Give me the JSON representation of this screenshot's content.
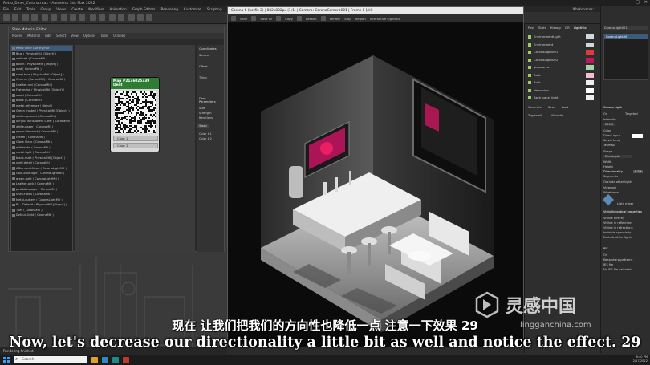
{
  "app": {
    "title": "Retro_Diner_Corona.max - Autodesk 3ds Max 2022",
    "workspace_label": "Workspaces:",
    "workspace_value": "Default",
    "menu": [
      "File",
      "Edit",
      "Tools",
      "Group",
      "Views",
      "Create",
      "Modifiers",
      "Animation",
      "Graph Editors",
      "Rendering",
      "Customize",
      "Scripting",
      "Content",
      "Civil View",
      "Substance"
    ]
  },
  "slate_editor": {
    "title": "Slate Material Editor",
    "menu": [
      "Modes",
      "Material",
      "Edit",
      "Select",
      "View",
      "Options",
      "Tools",
      "Utilities"
    ],
    "browser_items": [
      "Retro diner Library.mat",
      "Blue ( PhysicalMtl [Object] )",
      "wall-red ( CoronaMtl )",
      "booth ( PhysicalMtl [Object] )",
      "mat ( CoronaMtl )",
      "steel blue ( PhysicalMtl [Object] )",
      "Chrome (CoronaMtl) ( CoronaMtl )",
      "Leather-red ( CoronaMtl )",
      "Flat metal ( PhysicalMtl [Object] )",
      "wood ( CoronaMtl )",
      "Black ( CoronaMtl )",
      "metal-reference ( Blend )",
      "Green frosted ( PhysicalMtl [Object] )",
      "white-squared ( CoronaMtl )",
      "Acrylic Transparent Clear ( CoronaMtl )",
      "white-paper ( CoronaMtl )",
      "paper-tile-mark ( CoronaMtl )",
      "cream ( CoronaMtl )",
      "Glass Clear ( CoronaMtl )",
      "milkshake ( CoronaMtl )",
      "metal-light ( CoronaMtl )",
      "black-matt ( PhysicalMtl [Object] )",
      "shelf-detail ( CoronaMtl )",
      "ADiamond-Neon ( CoronaLightMtl )",
      "Gold-blue-light ( CoronaLightMtl )",
      "green-light ( CoronaLightMtl )",
      "Leather-pink ( CoronaMtl )",
      "pinkbike-paper ( CoronaMtl )",
      "Shell-Holes ( CoronaMtl )",
      "Metal-gutters ( CoronaLightMtl )",
      "Bl... Default ( PhysicalMtl [Object] )",
      "Tiles ( CoronaMtl )",
      "Default-light ( CoronaMtl )"
    ],
    "node_title": "Map #2136025339",
    "node_subtitle": "Dent",
    "node_port_1": "Color 1",
    "node_port_2": "Color 2",
    "params_title": "Coordinates",
    "params_source": "Source:",
    "params_offset": "Offset",
    "params_tiling": "Tiling",
    "params_dent": "Dent Parameters",
    "params_size": "Size",
    "params_strength": "Strength",
    "params_iterations": "Iterations",
    "params_swap": "Swap",
    "params_color1": "Color #1",
    "params_color2": "Color #2",
    "status": "Rendering finished"
  },
  "vfb": {
    "title": "Corona 6 (hotfix 2) | 882x882px (1:1) | Camera: CoronaCamera001 | Frame 0 [All]",
    "tools": [
      "Save",
      "Save all",
      "Copy",
      "Restart",
      "Render",
      "Stop",
      "Region",
      "Interactive LightMix"
    ],
    "tabs": [
      "Post",
      "Stats",
      "History",
      "DR",
      "LightMix"
    ]
  },
  "lightmix": {
    "rows": [
      {
        "label": "EnvironmentLight",
        "color": "#cfd8dc"
      },
      {
        "label": "Environment",
        "color": "#cfd8dc"
      },
      {
        "label": "CoronaLight001",
        "color": "#e53935"
      },
      {
        "label": "CoronaLight002",
        "color": "#c2185b"
      },
      {
        "label": "glass area",
        "color": "#a5d6a7"
      },
      {
        "label": "Bulb",
        "color": "#f8bbd0"
      },
      {
        "label": "Bulb",
        "color": "#eeeeee"
      },
      {
        "label": "Neon sign",
        "color": "#ffffff"
      },
      {
        "label": "Back panel light",
        "color": "#eeeeee"
      }
    ],
    "toggle_label": "Toggle all",
    "btn_generate": "Generate",
    "btn_save": "Save",
    "btn_load": "Load",
    "btn_all_white": "All white"
  },
  "command_panel": {
    "object_name": "CoronaLight001",
    "rollout_light": "Corona Light",
    "on_label": "On",
    "targeted_label": "Targeted",
    "intensity_label": "Intensity",
    "intensity_value": "200.0",
    "color_label": "Color",
    "direct_input": "Direct input",
    "kelvin": "Kelvin temp",
    "texmap": "Texmap",
    "shape_label": "Shape",
    "shape_value": "Rectangle",
    "width_label": "Width",
    "height_label": "Height",
    "directionality_label": "Directionality",
    "directionality_value": "0.29",
    "segments": "Segments",
    "occlude": "Occlude other lights",
    "viewport": "Viewport",
    "wireframe": "Wireframe",
    "light_icon": "Light mixer",
    "visibility_title": "Visibility/optical properties",
    "vis_items": [
      "Visible directly",
      "Visible in reflections",
      "Visible in refractions",
      "Invisible specularly",
      "Exclude other lights"
    ],
    "ies_title": "IES",
    "ies_on": "On",
    "keep_sharp": "Keep sharp patterns",
    "ies_file": "IES file",
    "no_ies": "No IES file selected"
  },
  "subtitle_cn": "现在 让我们把我们的方向性也降低一点 注意一下效果 29",
  "subtitle_en": "Now, let's decrease our directionality a little bit as well and notice the effect. 29",
  "watermark": {
    "text": "灵感中国",
    "url": "lingganchina.com"
  },
  "taskbar": {
    "search_placeholder": "Search",
    "time": "8:40 PM",
    "date": "2/17/2022"
  }
}
